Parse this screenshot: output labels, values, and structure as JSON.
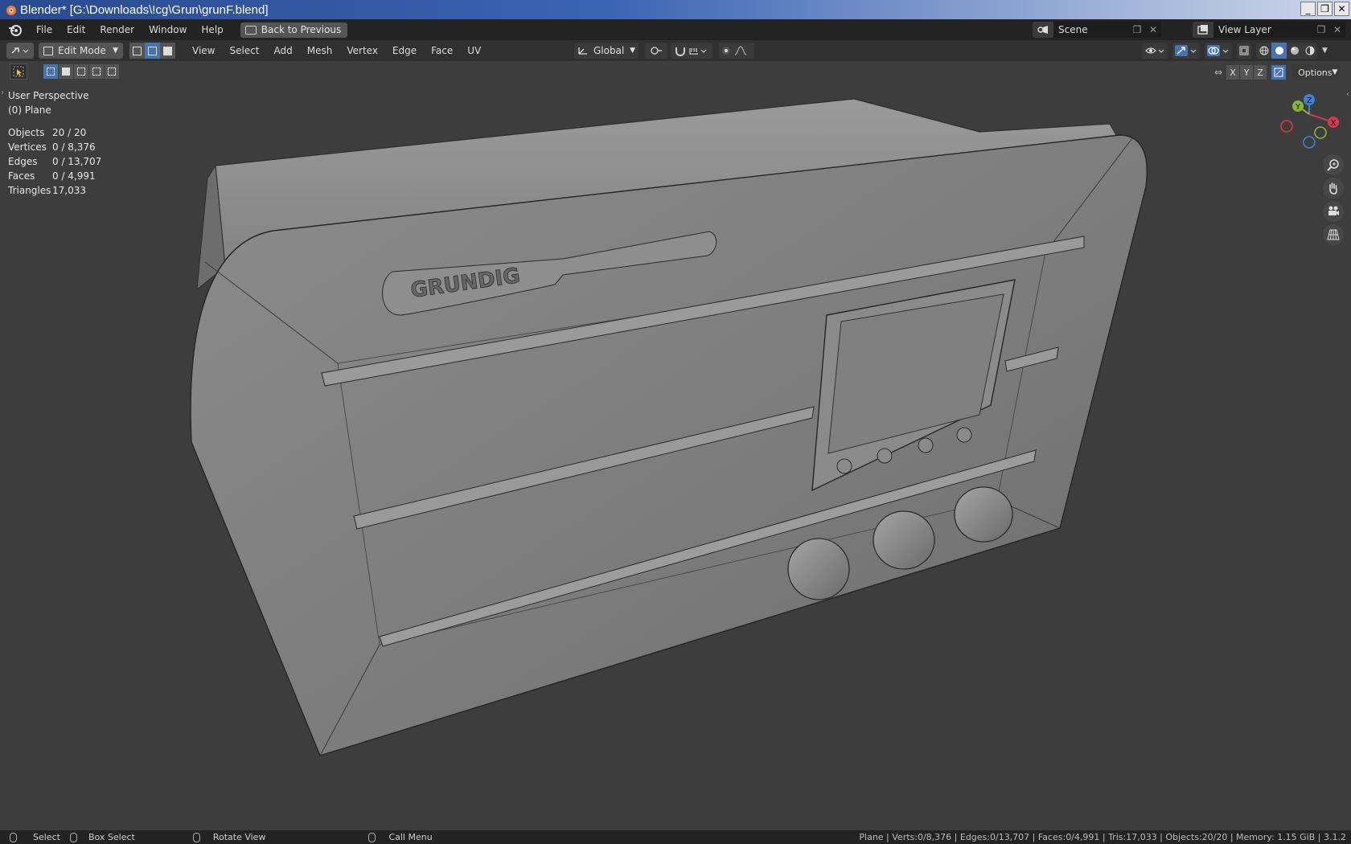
{
  "window": {
    "title": "Blender* [G:\\Downloads\\!cg\\Grun\\grunF.blend]",
    "controls": [
      "_",
      "❐",
      "✕"
    ]
  },
  "topbar": {
    "menus": [
      "File",
      "Edit",
      "Render",
      "Window",
      "Help"
    ],
    "back_button": "Back to Previous",
    "scene": "Scene",
    "view_layer": "View Layer"
  },
  "header": {
    "mode": "Edit Mode",
    "menus": [
      "View",
      "Select",
      "Add",
      "Mesh",
      "Vertex",
      "Edge",
      "Face",
      "UV"
    ],
    "transform_orientation": "Global",
    "options_label": "Options",
    "axes": [
      "X",
      "Y",
      "Z"
    ],
    "active_select_mode": "edge"
  },
  "viewport": {
    "view_name": "User Perspective",
    "object_name": "(0) Plane",
    "stats": [
      {
        "label": "Objects",
        "value": "20 / 20"
      },
      {
        "label": "Vertices",
        "value": "0 / 8,376"
      },
      {
        "label": "Edges",
        "value": "0 / 13,707"
      },
      {
        "label": "Faces",
        "value": "0 / 4,991"
      },
      {
        "label": "Triangles",
        "value": "17,033"
      }
    ],
    "logo_text": "GRUNDIG",
    "gizmo_axes": {
      "x": "X",
      "y": "Y",
      "z": "Z"
    },
    "axis_colors": {
      "x": "#d6394f",
      "y": "#8bb331",
      "z": "#3d82d6"
    }
  },
  "statusbar": {
    "select": "Select",
    "box_select": "Box Select",
    "rotate_view": "Rotate View",
    "call_menu": "Call Menu",
    "info": "Plane | Verts:0/8,376 | Edges:0/13,707 | Faces:0/4,991 | Tris:17,033 | Objects:20/20 | Memory: 1.15 GiB | 3.1.2"
  },
  "colors": {
    "accent": "#4772b3",
    "viewport_bg": "#3d3d3d"
  }
}
